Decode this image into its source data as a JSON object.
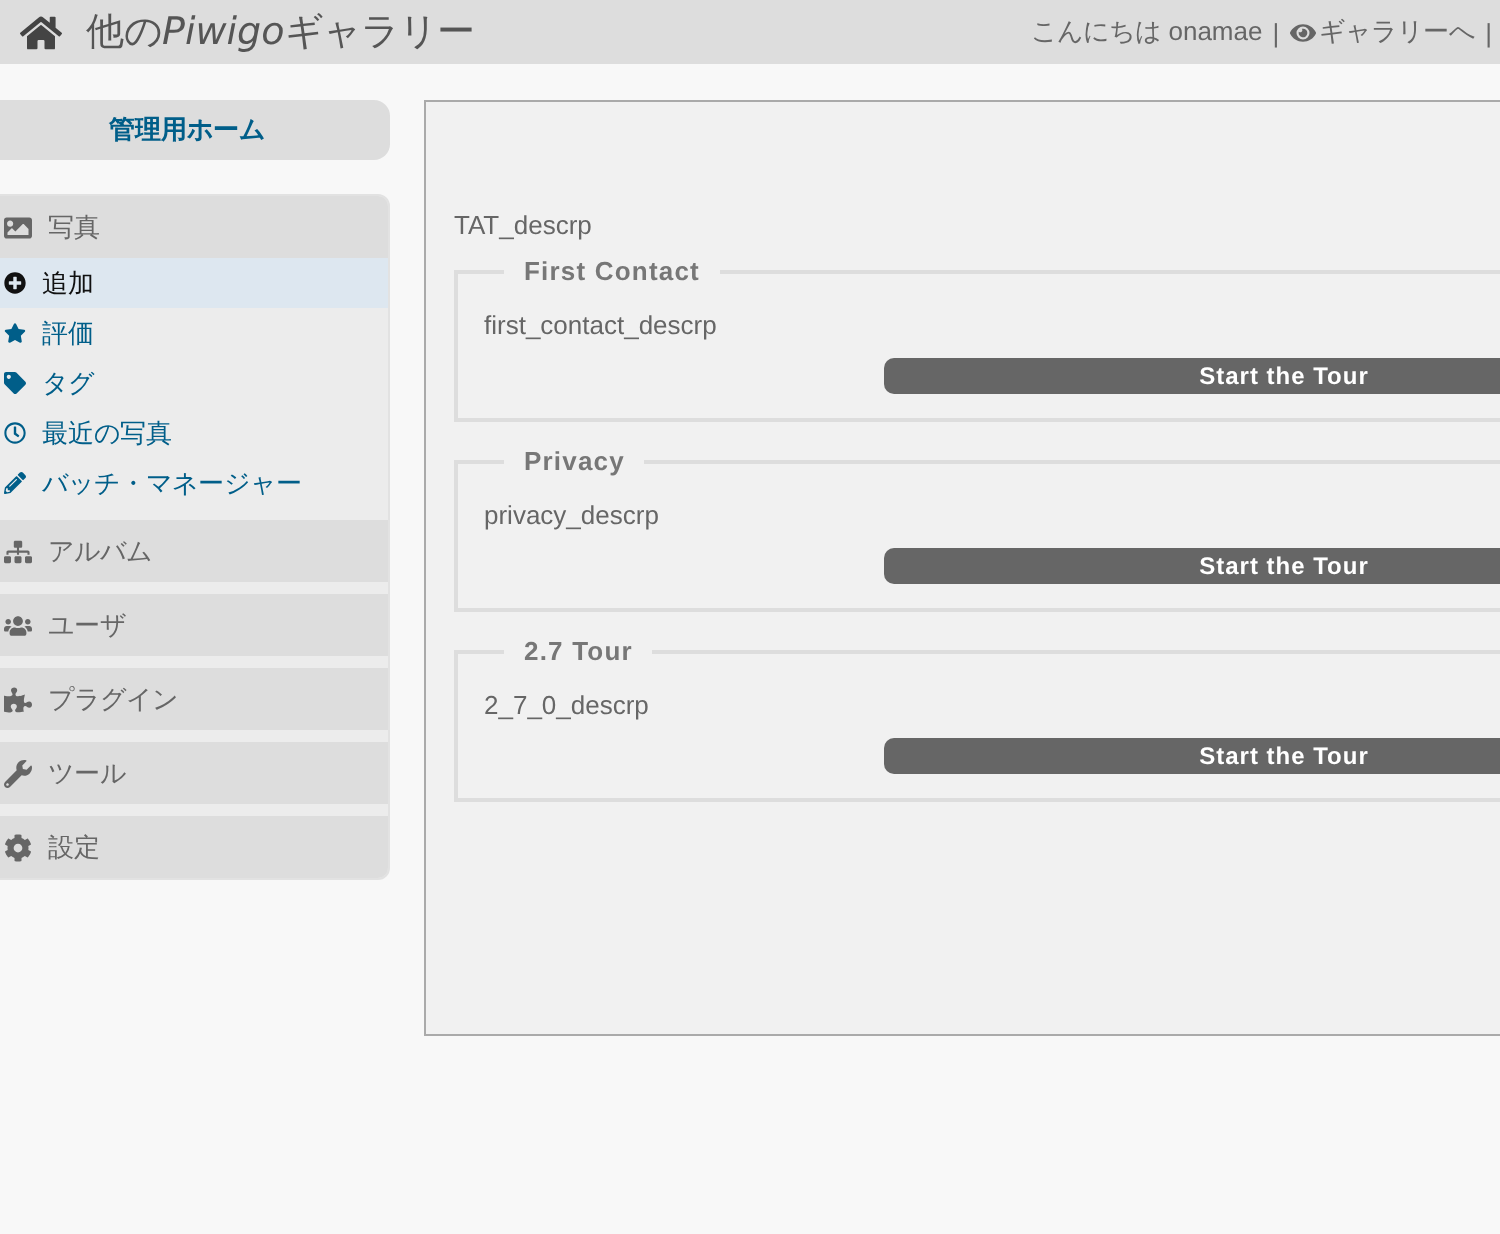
{
  "header": {
    "title_prefix": "他の",
    "title_brand": "Piwigo",
    "title_suffix": "ギャラリー",
    "greeting": "こんにちは onamae",
    "separator_1": "|",
    "gallery_link": "ギャラリーへ",
    "separator_2": "|"
  },
  "sidebar": {
    "home": "管理用ホーム",
    "sections": [
      {
        "label": "写真",
        "items": [
          {
            "label": "追加",
            "selected": true
          },
          {
            "label": "評価",
            "selected": false
          },
          {
            "label": "タグ",
            "selected": false
          },
          {
            "label": "最近の写真",
            "selected": false
          },
          {
            "label": "バッチ・マネージャー",
            "selected": false
          }
        ]
      },
      {
        "label": "アルバム"
      },
      {
        "label": "ユーザ"
      },
      {
        "label": "プラグイン"
      },
      {
        "label": "ツール"
      },
      {
        "label": "設定"
      }
    ]
  },
  "main": {
    "intro": "TAT_descrp",
    "tours": [
      {
        "title": "First Contact",
        "description": "first_contact_descrp",
        "button": "Start the Tour"
      },
      {
        "title": "Privacy",
        "description": "privacy_descrp",
        "button": "Start the Tour"
      },
      {
        "title": "2.7 Tour",
        "description": "2_7_0_descrp",
        "button": "Start the Tour"
      }
    ]
  }
}
